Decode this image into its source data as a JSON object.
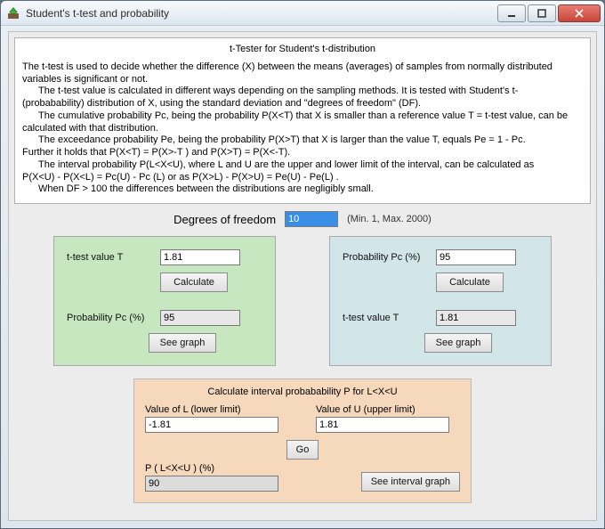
{
  "window": {
    "title": "Student's t-test and probability"
  },
  "description": {
    "heading": "t-Tester for Student's t-distribution",
    "p1": "The t-test is used to decide whether the difference (X) between the means (averages) of samples from normally distributed variables is significant or not.",
    "p2": "The t-test value is calculated in different ways depending on the sampling methods. It is tested with Student's t- (probabability) distribution of X, using the standard deviation and \"degrees of freedom\" (DF).",
    "p3": "The cumulative probability Pc, being the probability  P(X<T)  that  X  is smaller than a reference value  T  = t-test value,  can be calculated with that distribution.",
    "p4": "The exceedance probability  Pe,  being the probability  P(X>T)  that  X  is larger than the value  T,  equals  Pe = 1 - Pc.",
    "p5": "Further it holds that  P(X<T)  =  P(X>-T )   and  P(X>T)  =  P(X<-T).",
    "p6": "The interval probability  P(L<X<U),  where  L  and  U  are the upper and lower limit of the interval, can be calculated as",
    "p7": "P(X<U) - P(X<L)  =  Pc(U)  -  Pc (L)  or as  P(X>L)  -  P(X>U)  =  Pe(U)  -  Pe(L) .",
    "p8": "When  DF > 100  the differences between the distributions are negligibly small."
  },
  "dof": {
    "label": "Degrees of freedom",
    "value": "10",
    "minmax": "(Min. 1, Max. 2000)"
  },
  "left_panel": {
    "t_label": "t-test value T",
    "t_value": "1.81",
    "calc_label": "Calculate",
    "pc_label": "Probability Pc (%)",
    "pc_value": "95",
    "graph_label": "See graph"
  },
  "right_panel": {
    "pc_label": "Probability Pc (%)",
    "pc_value": "95",
    "calc_label": "Calculate",
    "t_label": "t-test value T",
    "t_value": "1.81",
    "graph_label": "See graph"
  },
  "interval": {
    "title": "Calculate interval probabability P for L<X<U",
    "l_label": "Value of L (lower limit)",
    "l_value": "-1.81",
    "u_label": "Value of U (upper limit)",
    "u_value": "1.81",
    "go_label": "Go",
    "p_label": "P ( L<X<U )  (%)",
    "p_value": "90",
    "graph_label": "See interval graph"
  }
}
